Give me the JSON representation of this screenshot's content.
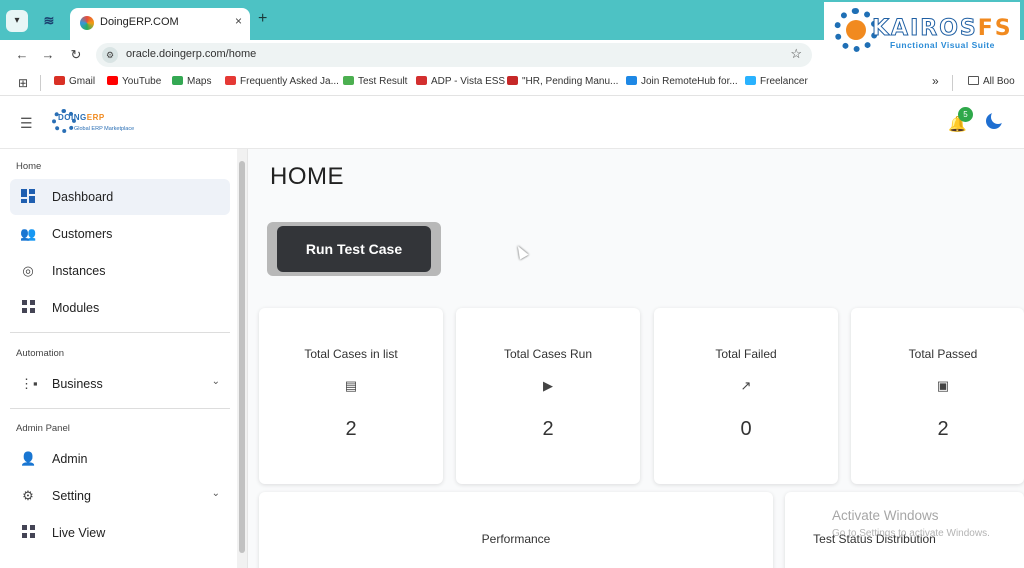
{
  "browser": {
    "tab_title": "DoingERP.COM",
    "tab_close": "×",
    "new_tab": "+",
    "url": "oracle.doingerp.com/home",
    "bookmarks": [
      {
        "label": "Gmail",
        "color": "#d93025"
      },
      {
        "label": "YouTube",
        "color": "#ff0000"
      },
      {
        "label": "Maps",
        "color": "#34a853"
      },
      {
        "label": "Frequently Asked Ja...",
        "color": "#e53935"
      },
      {
        "label": "Test Result",
        "color": "#4caf50"
      },
      {
        "label": "ADP - Vista ESS",
        "color": "#d32f2f"
      },
      {
        "label": "\"HR, Pending Manu...",
        "color": "#c62828"
      },
      {
        "label": "Join RemoteHub for...",
        "color": "#1e88e5"
      },
      {
        "label": "Freelancer",
        "color": "#29b2fe"
      }
    ],
    "bookmarks_overflow": "»",
    "all_bookmarks": "All Boo"
  },
  "overlay_logo": {
    "name_prefix": "KAIROS",
    "name_suffix": "FS",
    "tagline": "Functional Visual Suite"
  },
  "app": {
    "brand": {
      "name_prefix": "DOING",
      "name_suffix": "ERP",
      "tagline": "Global ERP Marketplace"
    },
    "notification_count": "5",
    "page_title": "HOME",
    "run_button_label": "Run Test Case",
    "sidebar": {
      "sections": [
        {
          "label": "Home"
        },
        {
          "label": "Automation"
        },
        {
          "label": "Admin Panel"
        }
      ],
      "items": [
        {
          "label": "Dashboard",
          "icon": "dashboard-icon"
        },
        {
          "label": "Customers",
          "icon": "people-icon"
        },
        {
          "label": "Instances",
          "icon": "instances-icon"
        },
        {
          "label": "Modules",
          "icon": "grid-icon"
        },
        {
          "label": "Business",
          "icon": "business-icon"
        },
        {
          "label": "Admin",
          "icon": "admin-icon"
        },
        {
          "label": "Setting",
          "icon": "setting-icon"
        },
        {
          "label": "Live View",
          "icon": "grid-icon"
        }
      ]
    },
    "stats": [
      {
        "title": "Total Cases in list",
        "icon": "list-icon",
        "value": "2"
      },
      {
        "title": "Total Cases Run",
        "icon": "play-icon",
        "value": "2"
      },
      {
        "title": "Total Failed",
        "icon": "trend-icon",
        "value": "0"
      },
      {
        "title": "Total Passed",
        "icon": "passed-icon",
        "value": "2"
      }
    ],
    "panels": [
      {
        "title": "Performance"
      },
      {
        "title": "Test Status Distribution"
      }
    ]
  },
  "os_watermark": {
    "title": "Activate Windows",
    "subtitle": "Go to Settings to activate Windows."
  }
}
